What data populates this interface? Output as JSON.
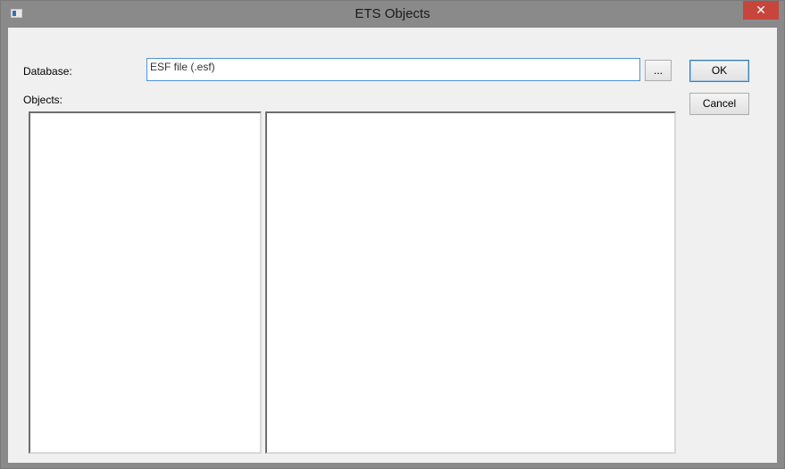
{
  "window": {
    "title": "ETS Objects",
    "close_glyph": "✕"
  },
  "form": {
    "database_label": "Database:",
    "database_value": "ESF file (.esf)",
    "browse_label": "...",
    "objects_label": "Objects:"
  },
  "buttons": {
    "ok_label": "OK",
    "cancel_label": "Cancel"
  },
  "icons": {
    "app": "app-window-icon",
    "close": "close-icon"
  },
  "colors": {
    "titlebar": "#8a8a8a",
    "close": "#c7463c",
    "input_focus": "#4d92d8",
    "client": "#f0f0f0"
  }
}
